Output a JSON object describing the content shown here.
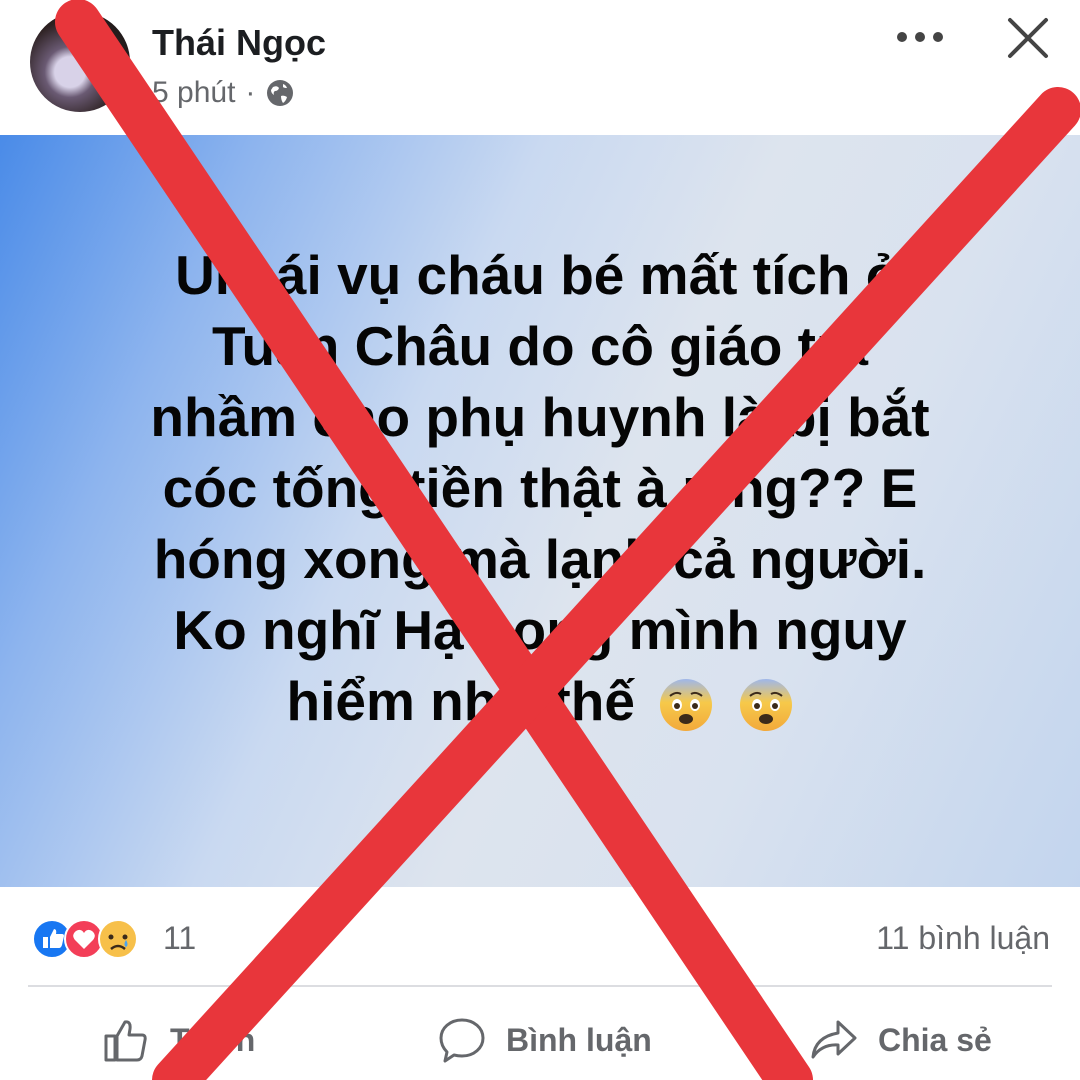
{
  "post": {
    "author": "Thái Ngọc",
    "time": "5 phút",
    "separator": "·",
    "text_lines": [
      "Ui cái vụ cháu bé mất tích ở",
      "Tuần Châu do cô giáo trả",
      "nhầm cho phụ huynh là bị bắt",
      "cóc tống tiền thật à mng?? E",
      "hóng xong mà lạnh cả người.",
      "Ko nghĩ Hạ Long mình nguy",
      "hiểm như thế"
    ],
    "text_emojis": [
      "anxious-face",
      "anxious-face"
    ]
  },
  "reactions": {
    "icons": [
      "like",
      "love",
      "sad"
    ],
    "count": "11",
    "comments": "11 bình luận"
  },
  "actions": {
    "like": "Thích",
    "comment": "Bình luận",
    "share": "Chia sẻ"
  },
  "colors": {
    "cross": "#e8363b",
    "like_blue": "#1877f2",
    "love_red": "#f33e58",
    "text": "#050505",
    "meta_gray": "#65676b"
  }
}
